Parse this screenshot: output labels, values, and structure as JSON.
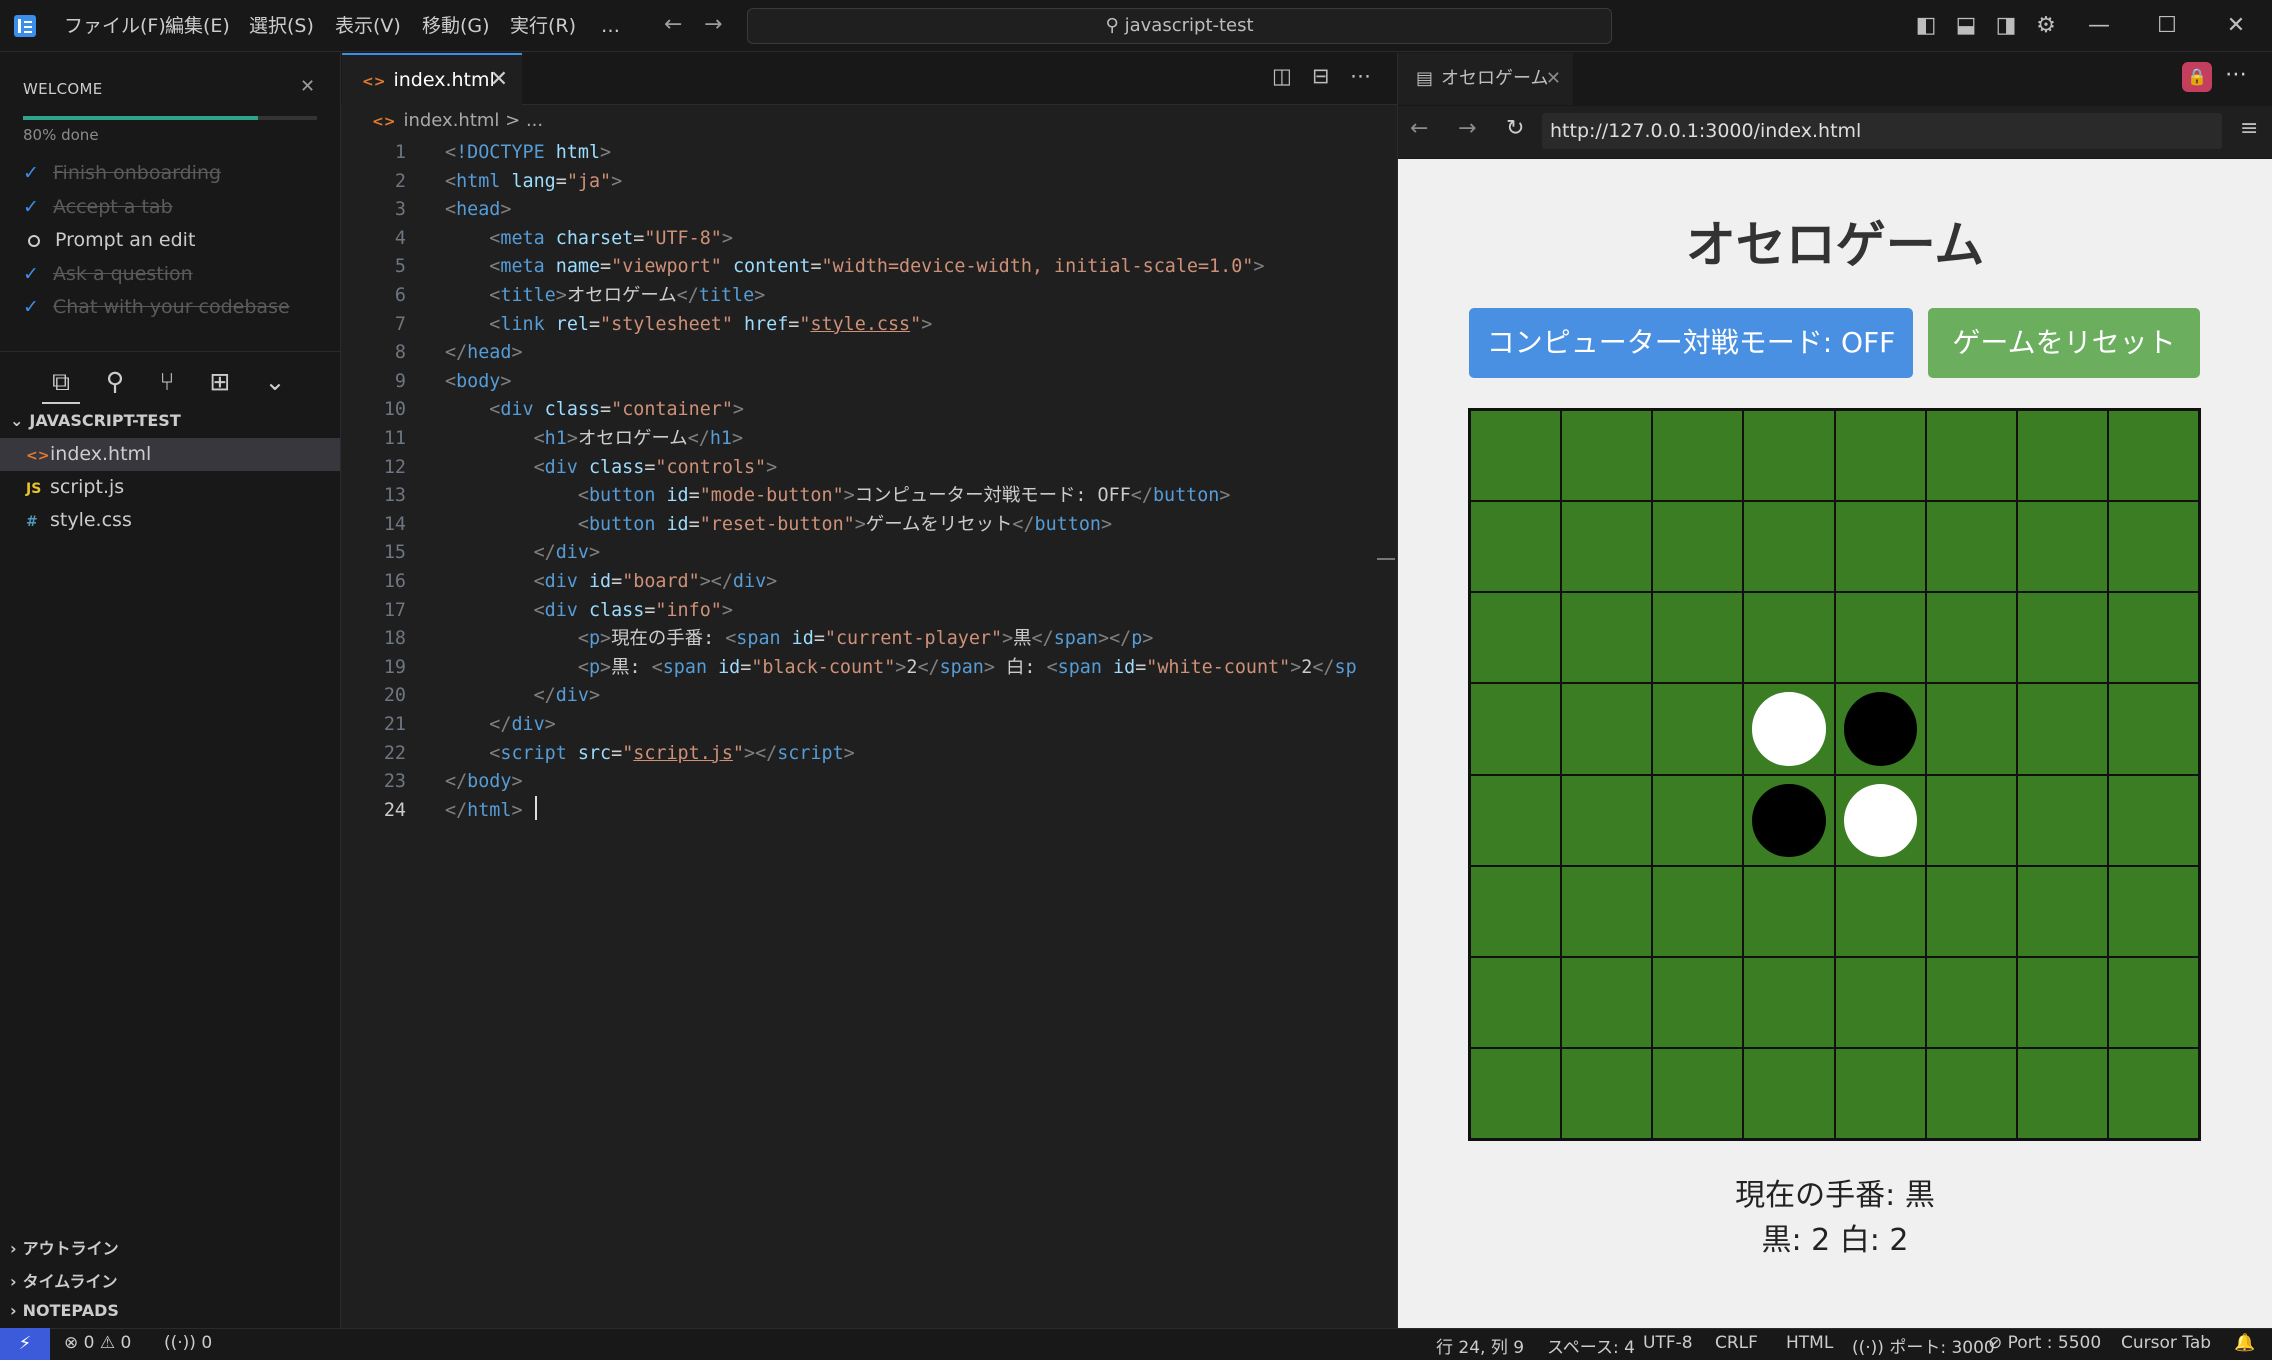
{
  "titlebar": {
    "menus": [
      "ファイル(F)",
      "編集(E)",
      "選択(S)",
      "表示(V)",
      "移動(G)",
      "実行(R)",
      "…"
    ],
    "search": "javascript-test",
    "nav_back": "←",
    "nav_forward": "→"
  },
  "welcome": {
    "title": "WELCOME",
    "progress_label": "80% done",
    "progress": 0.8,
    "steps": [
      {
        "label": "Finish onboarding",
        "done": true
      },
      {
        "label": "Accept a tab",
        "done": true
      },
      {
        "label": "Prompt an edit",
        "done": false
      },
      {
        "label": "Ask a question",
        "done": true
      },
      {
        "label": "Chat with your codebase",
        "done": true
      }
    ]
  },
  "explorer": {
    "header": "JAVASCRIPT-TEST",
    "files": [
      {
        "name": "index.html",
        "icon": "<>"
      },
      {
        "name": "script.js",
        "icon": "JS"
      },
      {
        "name": "style.css",
        "icon": "#"
      }
    ],
    "panels": [
      "アウトライン",
      "タイムライン",
      "NOTEPADS"
    ]
  },
  "editor": {
    "tab_label": "index.html",
    "breadcrumb": "index.html > ...",
    "cursor_line": 24
  },
  "browser": {
    "tab_label": "オセロゲーム",
    "url": "http://127.0.0.1:3000/index.html",
    "page_title": "オセロゲーム",
    "mode_button": "コンピューター対戦モード: OFF",
    "reset_button": "ゲームをリセット",
    "current_player": "現在の手番: 黒",
    "counts": "黒: 2 白: 2",
    "board": [
      "........",
      "........",
      "........",
      "...WB...",
      "...BW...",
      "........",
      "........",
      "........"
    ]
  },
  "statusbar": {
    "errors": "0",
    "warnings": "0",
    "ports": "0",
    "position": "行 24, 列 9",
    "spaces": "スペース: 4",
    "encoding": "UTF-8",
    "eol": "CRLF",
    "language": "HTML",
    "port": "ポート: 3000",
    "port2": "Port : 5500",
    "cursor_tab": "Cursor Tab"
  },
  "colors": {
    "accent": "#3b8eea",
    "board": "#3a7d22",
    "mode_button": "#4a90e2",
    "reset_button": "#6aae5e",
    "progress": "#2ea58b"
  }
}
